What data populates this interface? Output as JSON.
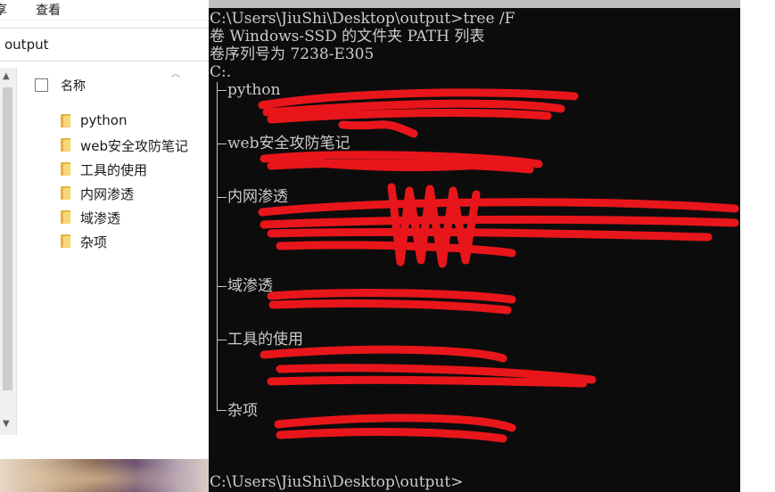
{
  "explorer": {
    "ribbon_tabs": [
      "享",
      "查看"
    ],
    "address": "output",
    "column_header": "名称",
    "items": [
      {
        "label": "python",
        "icon": "folder-icon"
      },
      {
        "label": "web安全攻防笔记",
        "icon": "folder-icon"
      },
      {
        "label": "工具的使用",
        "icon": "folder-icon"
      },
      {
        "label": "内网渗透",
        "icon": "folder-icon"
      },
      {
        "label": "域渗透",
        "icon": "folder-icon"
      },
      {
        "label": "杂项",
        "icon": "folder-icon"
      }
    ]
  },
  "console": {
    "command_line": "C:\\Users\\JiuShi\\Desktop\\output>tree /F",
    "volume_line": "卷 Windows-SSD 的文件夹 PATH 列表",
    "serial_line": "卷序列号为 7238-E305",
    "root": "C:.",
    "tree": [
      {
        "label": "python"
      },
      {
        "label": "web安全攻防笔记"
      },
      {
        "label": "内网渗透"
      },
      {
        "label": "域渗透"
      },
      {
        "label": "工具的使用"
      },
      {
        "label": "杂项"
      }
    ],
    "prompt": "C:\\Users\\JiuShi\\Desktop\\output>",
    "redaction_color": "#e8161b"
  }
}
